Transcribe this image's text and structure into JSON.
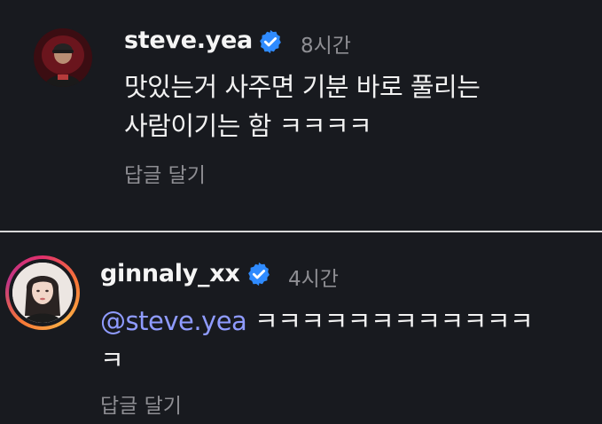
{
  "comments": [
    {
      "username": "steve.yea",
      "verified": true,
      "time": "8시간",
      "text_line1": "맛있는거 사주면 기분 바로 풀리는",
      "text_line2": "사람이기는 함 ㅋㅋㅋㅋ",
      "reply_label": "답글 달기",
      "avatar": "profile-photo-red-background"
    },
    {
      "username": "ginnaly_xx",
      "verified": true,
      "time": "4시간",
      "mention": "steve.yea",
      "text_line1": "ㅋㅋㅋㅋㅋㅋㅋㅋㅋㅋㅋㅋ",
      "text_line2": "ㅋ",
      "reply_label": "답글 달기",
      "avatar": "profile-photo-story-ring"
    }
  ],
  "colors": {
    "background": "#181a1f",
    "text": "#f2f2f2",
    "muted": "#8e8e93",
    "mention": "#8f9bff",
    "verified_badge": "#2f8bff"
  }
}
